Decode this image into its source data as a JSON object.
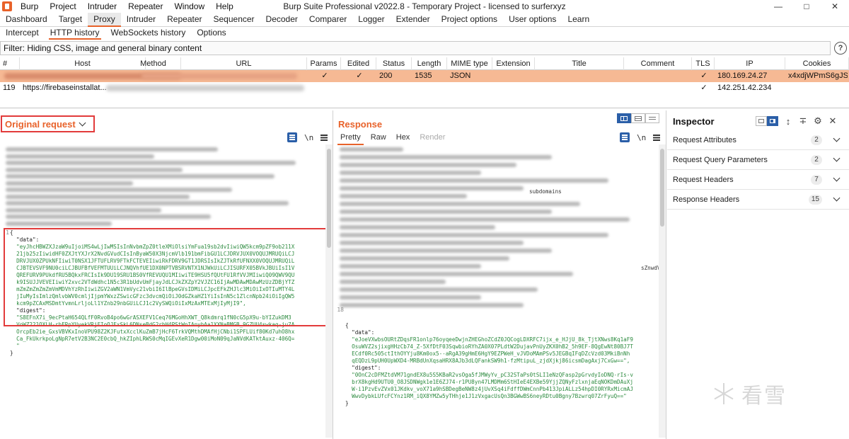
{
  "menu": [
    "Burp",
    "Project",
    "Intruder",
    "Repeater",
    "Window",
    "Help"
  ],
  "window_title": "Burp Suite Professional v2022.8 - Temporary Project - licensed to surferxyz",
  "top_tabs": [
    "Dashboard",
    "Target",
    "Proxy",
    "Intruder",
    "Repeater",
    "Sequencer",
    "Decoder",
    "Comparer",
    "Logger",
    "Extender",
    "Project options",
    "User options",
    "Learn"
  ],
  "active_top_tab": "Proxy",
  "sub_tabs": [
    "Intercept",
    "HTTP history",
    "WebSockets history",
    "Options"
  ],
  "active_sub_tab": "HTTP history",
  "filter_text": "Filter: Hiding CSS, image and general binary content",
  "table": {
    "columns": [
      "#",
      "Host",
      "Method",
      "URL",
      "Params",
      "Edited",
      "Status",
      "Length",
      "MIME type",
      "Extension",
      "Title",
      "Comment",
      "TLS",
      "IP",
      "Cookies"
    ],
    "rows": [
      {
        "num": "",
        "host": "",
        "method": "",
        "url": "",
        "params": "✓",
        "edited": "✓",
        "status": "200",
        "length": "1535",
        "mime": "JSON",
        "extension": "",
        "title": "",
        "comment": "",
        "tls": "✓",
        "ip": "180.169.24.27",
        "cookies": "x4xdjWPmS6gJS=",
        "selected": true
      },
      {
        "num": "119",
        "host": "https://firebaseinstallat...",
        "method": "",
        "url": "",
        "params": "",
        "edited": "",
        "status": "",
        "length": "",
        "mime": "",
        "extension": "",
        "title": "",
        "comment": "",
        "tls": "✓",
        "ip": "142.251.42.234",
        "cookies": "",
        "selected": false
      }
    ]
  },
  "request_pane": {
    "title": "Original request",
    "line_number": "1",
    "json_lines": [
      {
        "text": "{",
        "cls": "key"
      },
      {
        "text": "  \"data\":",
        "cls": "key"
      },
      {
        "text": "  \"eyJhcHBWZXJzaW9uIjoiMS4wLjIwMSIsInNvbmZpZ0tleXMiOlsiYmFua19sb2dvIiwiQW5kcm9pZF9ob211X",
        "cls": "str"
      },
      {
        "text": "  21jb25zIiwidHF0ZXJtYXJrX2NvdGVudCIsInByaW50X3NjcmVlb191bmFibGU1LCJDRVJUX0VOQUJMRUQiLCJ",
        "cls": "str"
      },
      {
        "text": "  DRVJUX0ZPUkNFIiwiT0NSX1JFTUFLRV9FTkFCTEVEIiwiRkFDRV9GT1JDRSIsIkZJTkRfUFNXX0VOQUJMRUQiL",
        "cls": "str"
      },
      {
        "text": "  CJBTEVSVF9NU0ciLCJBUFBfVEFMTUUiLCJNQVhfUE1DX0NPTVBSRVNTX1NJWkUiLCJISURFX05BVkJBUiIsI1V",
        "cls": "str"
      },
      {
        "text": "  QREFURV9PUkdfRU5BQkxFRCIsIk9DU19SRU1BS0VfREVUQU1MIiwiTE9HSU5fQUtFU1RfVVJMIiwiQ09QWV9QU",
        "cls": "str"
      },
      {
        "text": "  k9ISUJJVEVEIiwiY2xvc2VTdWdhc1N5c3R1bUdvUmFjayJdLCJkZXZpY2VJZC16IjAwMDAwMDAwMzUzZDBjYTZ",
        "cls": "str"
      },
      {
        "text": "  mZmZmZmZmZmVmMDVhYzRhIiwiZGV2aWN1VmVyc21vbiI6IlBpeGVsIDMiLCJpcEFkZHJlc3MiOiIxOTIuMTY4L",
        "cls": "str"
      },
      {
        "text": "  jIuMyIsImlzQmlvbWV0cmljIjpmYWxzZSwicGFzc3dvcmQiOiJ0dGZkaHZ1YiIsInN5c1ZlcnNpb24iOiIgQW5",
        "cls": "str"
      },
      {
        "text": "  kcm9pZCAxMSDmtYvmnLrljoLl1YZnb29nbGUiLCJ1c2VySWQiOiIxMzAxMTExMjIyMjI9\",",
        "cls": "str"
      },
      {
        "text": "  \"digest\":",
        "cls": "key"
      },
      {
        "text": "  \"S8EFnX7i_9ecPtaH654QLfF0RvoB4po6wGrASXEFV1Ceq76MGoHhXWT_Q8kdmrq1fN0cG5pX9u-bYIZukDM3",
        "cls": "str"
      },
      {
        "text": "  VoWZ221OXLH-rhFRpYUyekVRjFIoOJFxSkL6DNseBdG2rbH4PStWnIAnyhAa1XXNaBMGB_9GZUU4swkaq-ju7A",
        "cls": "str"
      },
      {
        "text": "  OrcpEb2ie_GxsVBVKxInoVPU98Z2KJFutxXcclKuZmB7jHcF6TrkVQMthDMAfHjCNbi1SPFLUif80Kd7uhO8hx",
        "cls": "str"
      },
      {
        "text": "  Ca_FkUkrkpoLgNpR7etV2B3NC2E0cbQ_hkZIphLRWS0cMqIGEvXeR1Dgw00iMoN09qJaNVdKATktAuxz-406Q=",
        "cls": "str"
      },
      {
        "text": "  \"",
        "cls": "str"
      },
      {
        "text": "}",
        "cls": "key"
      }
    ]
  },
  "response_pane": {
    "title": "Response",
    "tabs": [
      "Pretty",
      "Raw",
      "Hex",
      "Render"
    ],
    "active_tab": "Pretty",
    "line_number": "18",
    "json_lines": [
      {
        "text": "{",
        "cls": "key"
      },
      {
        "text": "  \"data\":",
        "cls": "key"
      },
      {
        "text": "  \"eJoeVXwbsOURtZDqsFR1onlp76oyqeeDwjnZHEGhoZCdZ0JQCogLDXRFC7ijx_e_HJjU_8k_TjtXNws8Kq1aF9",
        "cls": "str"
      },
      {
        "text": "  OsuWVZ2sjixgHHzCb74_Z-5XfDtF03SqwbioRYhZA0X07PLdtW2DujavPnUyZKX0hB2_5h9EF-8QgEwNt80BJ7T",
        "cls": "str"
      },
      {
        "text": "  ECdf0Rc505ctIthOYYju8Km0ox5--aRgA39gHmE6HgY9EZPWeH_vJVDoMAmPSv5JEGBqIFqDZcVzd03MkiBnNh",
        "cls": "str"
      },
      {
        "text": "  qEQDzL9pUH0UpWXD4-MRBdUnXqsaHRX8AJb3dLQFankSW9h1-fzMtipuL_zjdXjkj86icsmDagAxj7CxGw==\",",
        "cls": "str"
      },
      {
        "text": "  \"digest\":",
        "cls": "key"
      },
      {
        "text": "  \"0OnC2cDFMZtdVM71gndEX8u5S5KBaR2vsOga5fJMWyYv_pC32STaPs0tSLI1eNzQFasp2pGrvdyIoDNQ-rIs-v",
        "cls": "str"
      },
      {
        "text": "  brX8kgHd9UTU0_O8JSDNWgk1e1E6ZJ74-r1PU8yn47LMDMm6StHIeE4EXBe59YjjZQNyFzlxnjaEqNOKDmDAuXj",
        "cls": "str"
      },
      {
        "text": "  W-i1PzvEvZVx01JKdkv_voX71a9hSBDegBeNW8z4jUvXSq4iFdffDWmCnnPb413JpiALLz54hpDI0RYRxMicmAJ",
        "cls": "str"
      },
      {
        "text": "  WwvDybkLUfcFCYnz1RM_iQX8YMZw5yTHhje1J1zVxgacUsQn3BGWwBS6neyRDtu0Bgny7Bzwrq07ZrFyuQ==\"",
        "cls": "str"
      },
      {
        "text": "}",
        "cls": "key"
      }
    ],
    "visible_fragments": [
      "subdomains",
      "sZnwdVG;"
    ]
  },
  "inspector": {
    "title": "Inspector",
    "sections": [
      {
        "label": "Request Attributes",
        "count": "2"
      },
      {
        "label": "Request Query Parameters",
        "count": "2"
      },
      {
        "label": "Request Headers",
        "count": "7"
      },
      {
        "label": "Response Headers",
        "count": "15"
      }
    ]
  },
  "icons": {
    "line_numbers_toggle": "\\n",
    "help": "?"
  },
  "watermark": "看雪",
  "colors": {
    "accent": "#e8622a",
    "selected_row": "#f6b994",
    "string_green": "#2b8a3e",
    "highlight_box": "#e23b3b",
    "toggle_blue": "#2b5fa8"
  }
}
